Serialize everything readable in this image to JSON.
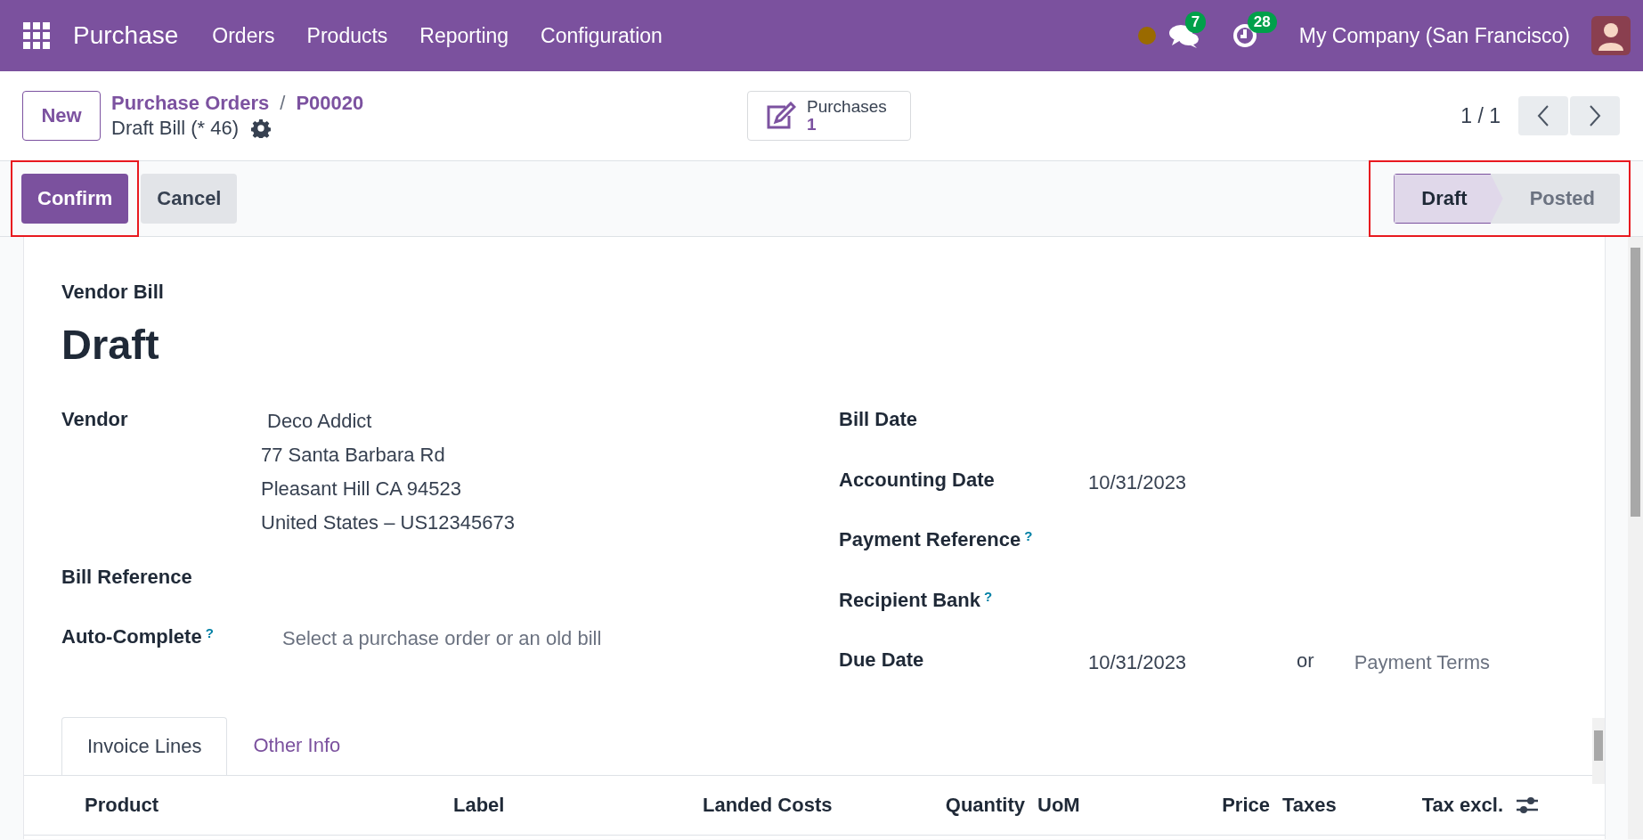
{
  "navbar": {
    "app_name": "Purchase",
    "menu": [
      "Orders",
      "Products",
      "Reporting",
      "Configuration"
    ],
    "messages_count": "7",
    "activities_count": "28",
    "company": "My Company (San Francisco)"
  },
  "control_panel": {
    "new_button": "New",
    "breadcrumbs": [
      "Purchase Orders",
      "P00020"
    ],
    "breadcrumb_separator": "/",
    "record_title": "Draft Bill (* 46)",
    "smart_button": {
      "label": "Purchases",
      "value": "1"
    },
    "pager": "1 / 1"
  },
  "action_bar": {
    "buttons": [
      {
        "label": "Confirm",
        "kind": "primary",
        "highlighted": true
      },
      {
        "label": "Cancel",
        "kind": "secondary",
        "highlighted": false
      }
    ],
    "status": {
      "highlighted": true,
      "stages": [
        {
          "label": "Draft",
          "selected": true
        },
        {
          "label": "Posted",
          "selected": false
        }
      ]
    }
  },
  "form": {
    "type_label": "Vendor Bill",
    "title": "Draft",
    "left_fields": [
      {
        "label": "Vendor",
        "lines": [
          "Deco Addict",
          "77 Santa Barbara Rd",
          "Pleasant Hill CA 94523",
          "United States – US12345673"
        ]
      },
      {
        "label": "Bill Reference"
      },
      {
        "label": "Auto-Complete",
        "help_mark": "?",
        "placeholder": "Select a purchase order or an old bill"
      }
    ],
    "right_fields": [
      {
        "label": "Bill Date"
      },
      {
        "label": "Accounting Date",
        "value": "10/31/2023"
      },
      {
        "label": "Payment Reference",
        "help_mark": "?"
      },
      {
        "label": "Recipient Bank",
        "help_mark": "?"
      },
      {
        "label": "Due Date",
        "value": "10/31/2023",
        "separator": "or",
        "placeholder": "Payment Terms"
      }
    ],
    "tabs": [
      {
        "label": "Invoice Lines",
        "selected": true
      },
      {
        "label": "Other Info",
        "selected": false
      }
    ],
    "columns": [
      "Product",
      "Label",
      "Landed Costs",
      "Quantity",
      "UoM",
      "Price",
      "Taxes",
      "Tax excl."
    ]
  }
}
